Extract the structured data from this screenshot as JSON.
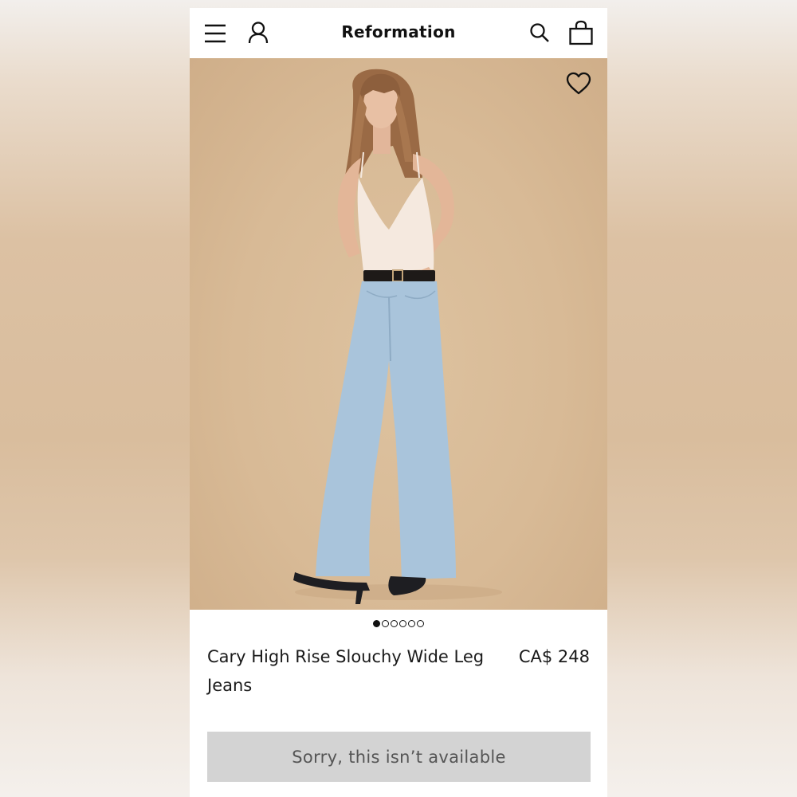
{
  "app": {
    "brand": "Reformation"
  },
  "header": {
    "icons": [
      "menu-icon",
      "account-icon",
      "search-icon",
      "shopping-bag-icon"
    ]
  },
  "product": {
    "name": "Cary High Rise Slouchy Wide Leg Jeans",
    "price": "CA$ 248",
    "availability_button": "Sorry, this isn’t available",
    "image_count": 6,
    "active_image_index": 0
  },
  "colors": {
    "image_background": "#d8ba96",
    "button_background": "#d3d3d3",
    "button_text": "#555555",
    "text": "#1a1a1a"
  }
}
